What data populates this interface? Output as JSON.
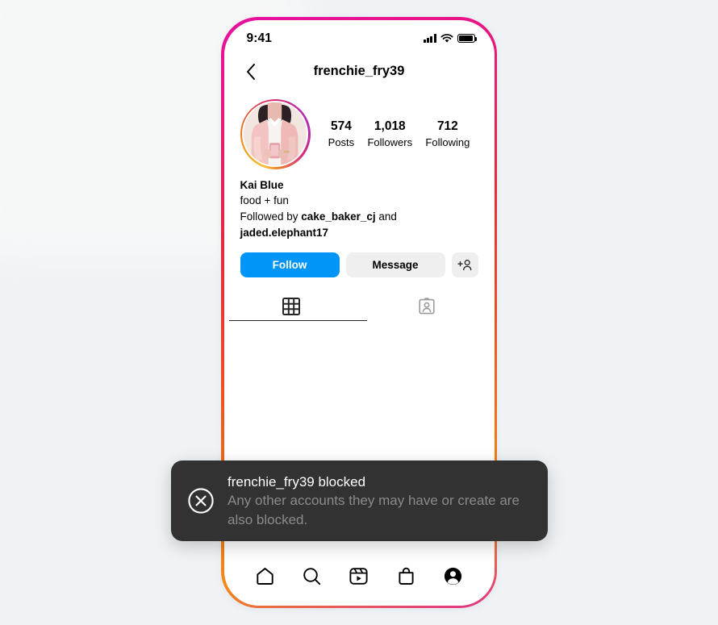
{
  "canvas": {
    "background_color": "#eff3f6"
  },
  "phone": {
    "frame_gradient": [
      "#e611a0",
      "#e5273f",
      "#ef7316",
      "#f08a1a"
    ]
  },
  "status_bar": {
    "time": "9:41",
    "icons": [
      "cellular-signal-icon",
      "wifi-icon",
      "battery-icon"
    ]
  },
  "header": {
    "back_icon": "chevron-left-icon",
    "title": "frenchie_fry39"
  },
  "profile": {
    "avatar_label": "profile-photo",
    "stats": [
      {
        "value": "574",
        "label": "Posts"
      },
      {
        "value": "1,018",
        "label": "Followers"
      },
      {
        "value": "712",
        "label": "Following"
      }
    ],
    "bio": {
      "name": "Kai Blue",
      "description": "food + fun",
      "followed_by_prefix": "Followed by ",
      "followed_by_user1": "cake_baker_cj",
      "followed_by_conjunction": " and ",
      "followed_by_user2": "jaded.elephant17"
    },
    "actions": {
      "follow_label": "Follow",
      "follow_color": "#0095f6",
      "message_label": "Message",
      "message_color": "#efefef",
      "adduser_icon": "add-person-icon"
    }
  },
  "tabs": [
    {
      "name": "grid-tab",
      "icon": "grid-icon",
      "active": true
    },
    {
      "name": "tagged-tab",
      "icon": "person-card-icon",
      "active": false
    }
  ],
  "toast": {
    "icon": "circle-x-icon",
    "title": "frenchie_fry39 blocked",
    "subtitle": "Any other accounts they may have or create are also blocked.",
    "background_color": "#323232",
    "title_color": "#ffffff",
    "subtitle_color": "#8a8a8a"
  },
  "bottom_nav": [
    {
      "name": "home",
      "icon": "home-icon",
      "active": false
    },
    {
      "name": "search",
      "icon": "search-icon",
      "active": false
    },
    {
      "name": "reels",
      "icon": "reels-icon",
      "active": false
    },
    {
      "name": "shop",
      "icon": "shop-bag-icon",
      "active": false
    },
    {
      "name": "profile",
      "icon": "profile-filled-icon",
      "active": true
    }
  ]
}
